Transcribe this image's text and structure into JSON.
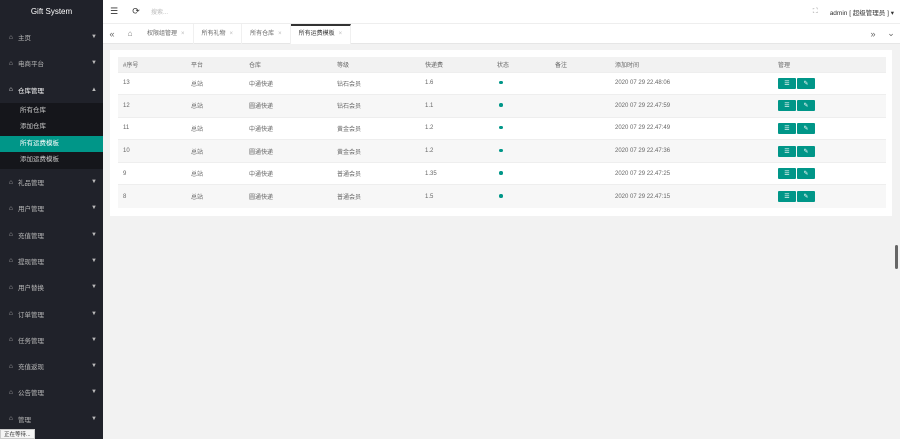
{
  "app": {
    "title": "Gift System"
  },
  "sidebar": {
    "items": [
      {
        "label": "主页"
      },
      {
        "label": "电商平台"
      },
      {
        "label": "仓库管理",
        "open": true,
        "children": [
          {
            "label": "所有仓库"
          },
          {
            "label": "添加仓库"
          },
          {
            "label": "所有运费模板",
            "active": true
          },
          {
            "label": "添加运费模板"
          }
        ]
      },
      {
        "label": "礼品管理"
      },
      {
        "label": "用户管理"
      },
      {
        "label": "充值管理"
      },
      {
        "label": "提现管理"
      },
      {
        "label": "用户替换"
      },
      {
        "label": "订单管理"
      },
      {
        "label": "任务管理"
      },
      {
        "label": "充值返现"
      },
      {
        "label": "公告管理"
      },
      {
        "label": "管理"
      }
    ],
    "status_tip": "正在等待..."
  },
  "header": {
    "search_placeholder": "搜索...",
    "user": "admin [ 超级管理员 ] ▾"
  },
  "tabs": [
    {
      "label": "权限组管理"
    },
    {
      "label": "所有礼物"
    },
    {
      "label": "所有仓库"
    },
    {
      "label": "所有运费模板",
      "active": true
    }
  ],
  "table": {
    "columns": [
      "#序号",
      "平台",
      "仓库",
      "等级",
      "快递费",
      "状态",
      "备注",
      "添加时间",
      "管理"
    ],
    "rows": [
      {
        "id": "13",
        "platform": "总站",
        "warehouse": "中通快递",
        "level": "钻石会员",
        "fee": "1.6",
        "remark": "",
        "time": "2020 07 29 22.48:06"
      },
      {
        "id": "12",
        "platform": "总站",
        "warehouse": "圆通快递",
        "level": "钻石会员",
        "fee": "1.1",
        "remark": "",
        "time": "2020 07 29 22.47:59"
      },
      {
        "id": "11",
        "platform": "总站",
        "warehouse": "中通快递",
        "level": "黄金会员",
        "fee": "1.2",
        "remark": "",
        "time": "2020 07 29 22.47:49"
      },
      {
        "id": "10",
        "platform": "总站",
        "warehouse": "圆通快递",
        "level": "黄金会员",
        "fee": "1.2",
        "remark": "",
        "time": "2020 07 29 22.47:36"
      },
      {
        "id": "9",
        "platform": "总站",
        "warehouse": "中通快递",
        "level": "普通会员",
        "fee": "1.35",
        "remark": "",
        "time": "2020 07 29 22.47:25"
      },
      {
        "id": "8",
        "platform": "总站",
        "warehouse": "圆通快递",
        "level": "普通会员",
        "fee": "1.5",
        "remark": "",
        "time": "2020 07 29 22.47:15"
      }
    ]
  },
  "colors": {
    "accent": "#009688",
    "sidebar_bg": "#20222a",
    "submenu_bg": "#15161b"
  }
}
